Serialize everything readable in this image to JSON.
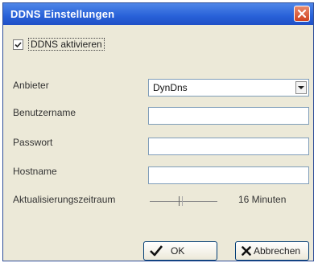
{
  "window": {
    "title": "DDNS Einstellungen"
  },
  "enable": {
    "label": "DDNS aktivieren",
    "checked": true
  },
  "fields": {
    "provider_label": "Anbieter",
    "provider_value": "DynDns",
    "username_label": "Benutzername",
    "username_value": "",
    "password_label": "Passwort",
    "password_value": "",
    "hostname_label": "Hostname",
    "hostname_value": ""
  },
  "update": {
    "label": "Aktualisierungszeitraum",
    "value_text": "16  Minuten",
    "level": 0.45
  },
  "buttons": {
    "ok_label": "OK",
    "cancel_label": "Abbrechen"
  },
  "colors": {
    "titlebar": "#2861d8",
    "window_bg": "#ece9d8",
    "field_border": "#7f9db9",
    "close": "#d0431f"
  }
}
